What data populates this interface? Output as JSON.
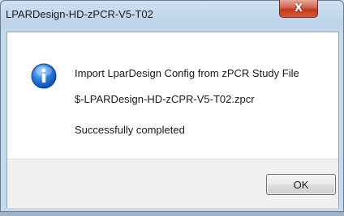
{
  "window": {
    "title": "LPARDesign-HD-zPCR-V5-T02",
    "close_glyph": "X"
  },
  "message": {
    "icon": "info-icon",
    "line1": "Import LparDesign Config from zPCR Study File",
    "line2": "$-LPARDesign-HD-zCPR-V5-T02.zpcr",
    "line3": "Successfully completed"
  },
  "buttons": {
    "ok_label": "OK"
  },
  "colors": {
    "info_icon": "#1f6fd1",
    "close_button": "#c8442c"
  }
}
